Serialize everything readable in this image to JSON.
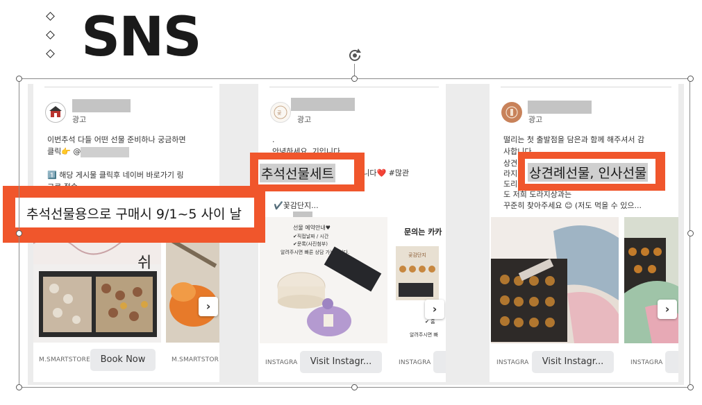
{
  "slide": {
    "title": "SNS"
  },
  "ads": [
    {
      "ad_label": "광고",
      "lines": [
        "이번추석 다들 어떤 선물 준비하나 궁금하면",
        "클릭👉 @",
        "",
        "1️⃣ 해당 게시물 클릭후 네이버 바로가기 링",
        "크로 접속"
      ],
      "image_text": "쉬",
      "domain_1": "M.SMARTSTORE",
      "cta_1": "Book Now",
      "domain_2": "M.SMARTSTOR"
    },
    {
      "ad_label": "광고",
      "lines": [
        ".",
        "안녕하세요  기입니다",
        "",
        "있습니다❤️ #많관",
        "",
        "✔️꽃감단지..."
      ],
      "image_lines": [
        "선물 예약안내♥",
        "✔직접날짜 / 시간",
        "✔문록(사진첨부)",
        "알려주시면 빠른 상담 가능합니다."
      ],
      "side_title": "문의는 카카",
      "side_box": "곶감단지",
      "side_lines": [
        "✔ 홈",
        "알려주시면 빠"
      ],
      "domain_1": "INSTAGRA",
      "cta_1": "Visit Instagr...",
      "domain_2": "INSTAGRA"
    },
    {
      "ad_label": "광고",
      "lines": [
        "떨리는 첫 출발점을 담은과 함께 해주셔서 감",
        "사합니다",
        "상견",
        "라지",
        "도리",
        "도 저희 도라지상과는",
        "꾸준히 찾아주세요 😊 (저도 먹을 수 있으..."
      ],
      "domain_1": "INSTAGRA",
      "cta_1": "Visit Instagr...",
      "domain_2": "INSTAGRA"
    }
  ],
  "highlights": {
    "chuseok_purchase": "추석선물용으로 구매시 9/1~5 사이 날",
    "chuseok_set": "추석선물세트",
    "greeting_gift": "상견례선물, 인사선물"
  },
  "colors": {
    "accent_orange": "#f0562c",
    "mask_gray": "#c4c4c4"
  }
}
